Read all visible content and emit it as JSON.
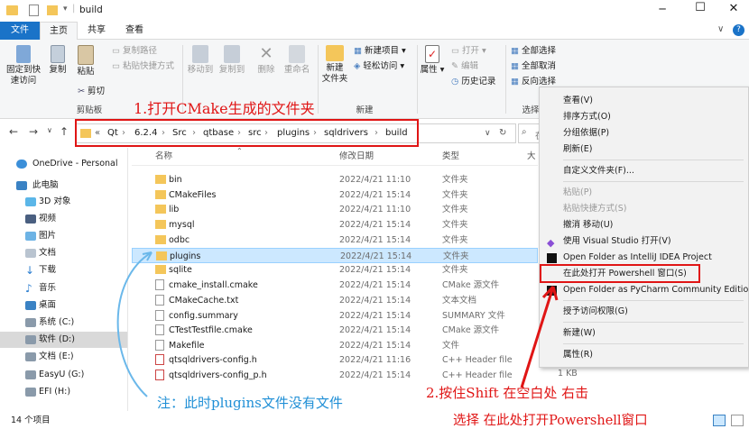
{
  "window": {
    "title": "build"
  },
  "tabs": [
    {
      "label": "文件"
    },
    {
      "label": "主页"
    },
    {
      "label": "共享"
    },
    {
      "label": "查看"
    }
  ],
  "ribbon": {
    "pin_label_1": "固定到快",
    "pin_label_2": "速访问",
    "copy": "复制",
    "paste": "粘贴",
    "cut": "剪切",
    "copy_path": "复制路径",
    "paste_shortcut": "粘贴快捷方式",
    "clipboard_group": "剪贴板",
    "move_to": "移动到",
    "copy_to": "复制到",
    "delete": "删除",
    "rename": "重命名",
    "new_folder_1": "新建",
    "new_folder_2": "文件夹",
    "new_item": "新建项目",
    "easy_access": "轻松访问",
    "new_group": "新建",
    "properties": "属性",
    "open": "打开",
    "edit": "编辑",
    "history": "历史记录",
    "select_all": "全部选择",
    "select_none": "全部取消",
    "invert_selection": "反向选择",
    "select_group": "选择"
  },
  "address": {
    "crumbs": [
      "Qt",
      "6.2.4",
      "Src",
      "qtbase",
      "src",
      "plugins",
      "sqldrivers",
      "build"
    ],
    "search_placeholder": "在"
  },
  "sidebar": {
    "items": [
      {
        "label": "OneDrive - Personal"
      },
      {
        "label": "此电脑"
      },
      {
        "label": "3D 对象"
      },
      {
        "label": "视频"
      },
      {
        "label": "图片"
      },
      {
        "label": "文档"
      },
      {
        "label": "下载"
      },
      {
        "label": "音乐"
      },
      {
        "label": "桌面"
      },
      {
        "label": "系统 (C:)"
      },
      {
        "label": "软件 (D:)"
      },
      {
        "label": "文档 (E:)"
      },
      {
        "label": "EasyU (G:)"
      },
      {
        "label": "EFI (H:)"
      }
    ]
  },
  "files": {
    "headers": {
      "name": "名称",
      "date": "修改日期",
      "type": "类型",
      "size": "大"
    },
    "rows": [
      {
        "name": "bin",
        "date": "2022/4/21 11:10",
        "type": "文件夹",
        "kind": "folder"
      },
      {
        "name": "CMakeFiles",
        "date": "2022/4/21 15:14",
        "type": "文件夹",
        "kind": "folder"
      },
      {
        "name": "lib",
        "date": "2022/4/21 11:10",
        "type": "文件夹",
        "kind": "folder"
      },
      {
        "name": "mysql",
        "date": "2022/4/21 15:14",
        "type": "文件夹",
        "kind": "folder"
      },
      {
        "name": "odbc",
        "date": "2022/4/21 15:14",
        "type": "文件夹",
        "kind": "folder"
      },
      {
        "name": "plugins",
        "date": "2022/4/21 15:14",
        "type": "文件夹",
        "kind": "folder"
      },
      {
        "name": "sqlite",
        "date": "2022/4/21 15:14",
        "type": "文件夹",
        "kind": "folder"
      },
      {
        "name": "cmake_install.cmake",
        "date": "2022/4/21 15:14",
        "type": "CMake 源文件",
        "kind": "file"
      },
      {
        "name": "CMakeCache.txt",
        "date": "2022/4/21 15:14",
        "type": "文本文档",
        "kind": "file"
      },
      {
        "name": "config.summary",
        "date": "2022/4/21 15:14",
        "type": "SUMMARY 文件",
        "kind": "file"
      },
      {
        "name": "CTestTestfile.cmake",
        "date": "2022/4/21 15:14",
        "type": "CMake 源文件",
        "kind": "file"
      },
      {
        "name": "Makefile",
        "date": "2022/4/21 15:14",
        "type": "文件",
        "kind": "file"
      },
      {
        "name": "qtsqldrivers-config.h",
        "date": "2022/4/21 11:16",
        "type": "C++ Header file",
        "kind": "header"
      },
      {
        "name": "qtsqldrivers-config_p.h",
        "date": "2022/4/21 15:14",
        "type": "C++ Header file",
        "kind": "header"
      }
    ],
    "last_size": "1 KB"
  },
  "status": {
    "count": "14 个项目"
  },
  "context_menu": {
    "items": [
      {
        "label": "查看(V)",
        "disabled": false
      },
      {
        "label": "排序方式(O)",
        "disabled": false
      },
      {
        "label": "分组依据(P)",
        "disabled": false
      },
      {
        "label": "刷新(E)",
        "disabled": false
      },
      {
        "label": "自定义文件夹(F)...",
        "disabled": false
      },
      {
        "label": "粘贴(P)",
        "disabled": true
      },
      {
        "label": "粘贴快捷方式(S)",
        "disabled": true
      },
      {
        "label": "撤消 移动(U)",
        "disabled": false
      },
      {
        "label": "使用 Visual Studio 打开(V)",
        "disabled": false
      },
      {
        "label": "Open Folder as IntelliJ IDEA Project",
        "disabled": false
      },
      {
        "label": "在此处打开 Powershell 窗口(S)",
        "disabled": false
      },
      {
        "label": "Open Folder as PyCharm Community Edition",
        "disabled": false
      },
      {
        "label": "授予访问权限(G)",
        "disabled": false
      },
      {
        "label": "新建(W)",
        "disabled": false
      },
      {
        "label": "属性(R)",
        "disabled": false
      }
    ]
  },
  "annotations": {
    "step1": "1.打开CMake生成的文件夹",
    "step2": "2.按住Shift 在空白处 右击",
    "step3": "选择 在此处打开Powershell窗口",
    "note": "注：此时plugins文件没有文件"
  },
  "colors": {
    "accent": "#1a73c8",
    "annotation_red": "#e01515",
    "annotation_blue": "#1f8fd6",
    "selection": "#cce8ff"
  }
}
